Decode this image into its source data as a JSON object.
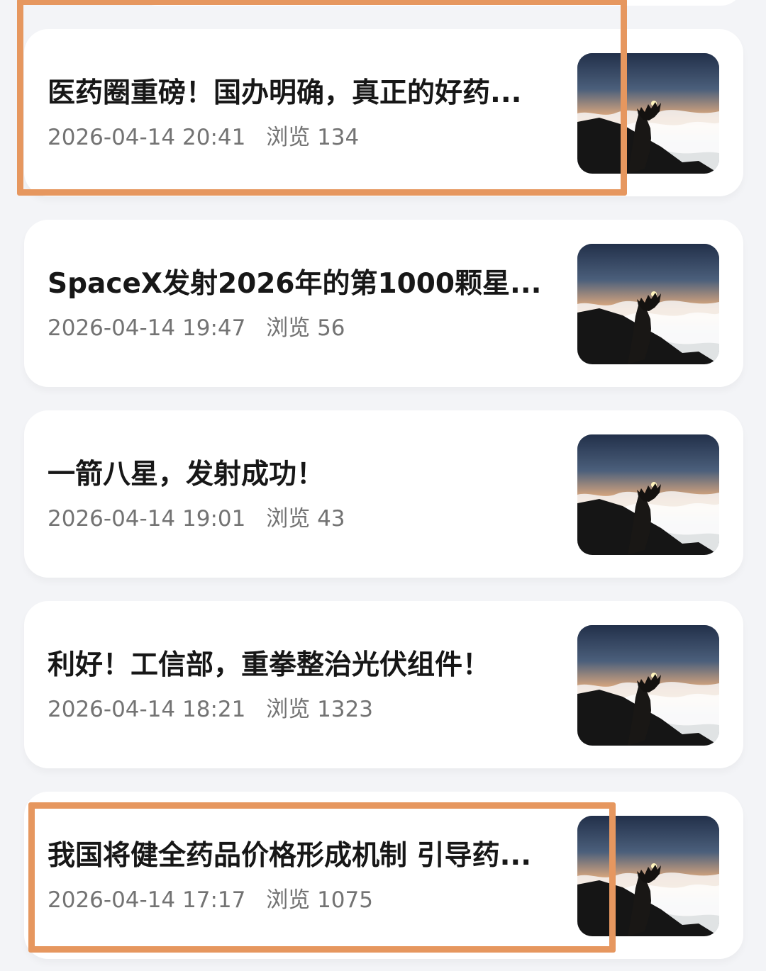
{
  "feed": {
    "views_label": "浏览",
    "items": [
      {
        "title": "医药圈重磅！国办明确，真正的好药...",
        "time": "2026-04-14 20:41",
        "views": "134",
        "highlighted": true,
        "thumbnail": "sunrise-above-clouds-hand-photo"
      },
      {
        "title": "SpaceX发射2026年的第1000颗星...",
        "time": "2026-04-14 19:47",
        "views": "56",
        "highlighted": false,
        "thumbnail": "sunrise-above-clouds-hand-photo"
      },
      {
        "title": "一箭八星，发射成功！",
        "time": "2026-04-14 19:01",
        "views": "43",
        "highlighted": false,
        "thumbnail": "sunrise-above-clouds-hand-photo"
      },
      {
        "title": "利好！工信部，重拳整治光伏组件！",
        "time": "2026-04-14 18:21",
        "views": "1323",
        "highlighted": false,
        "thumbnail": "sunrise-above-clouds-hand-photo"
      },
      {
        "title": "我国将健全药品价格形成机制 引导药...",
        "time": "2026-04-14 17:17",
        "views": "1075",
        "highlighted": true,
        "thumbnail": "sunrise-above-clouds-hand-photo"
      }
    ]
  },
  "colors": {
    "background": "#f3f4f7",
    "card": "#ffffff",
    "title": "#171717",
    "meta": "#737373",
    "highlight_border": "#e6975f"
  }
}
